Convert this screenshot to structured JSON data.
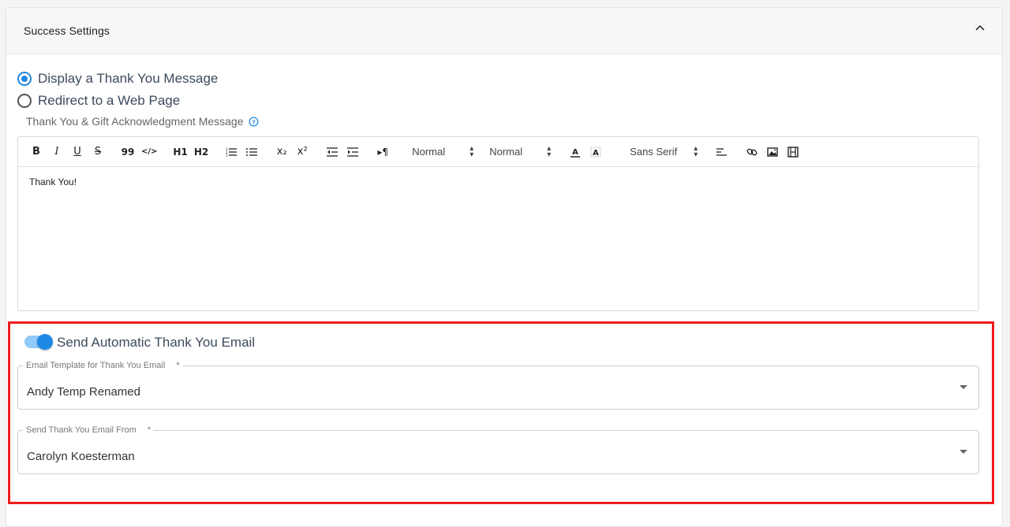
{
  "section": {
    "title": "Success Settings"
  },
  "options": {
    "display_message": "Display a Thank You Message",
    "redirect": "Redirect to a Web Page"
  },
  "message": {
    "label": "Thank You & Gift Acknowledgment Message",
    "body": "Thank You!"
  },
  "toolbar": {
    "bold": "B",
    "italic": "I",
    "underline": "U",
    "strike": "S",
    "blockquote": "99",
    "code": "</>",
    "h1": "H1",
    "h2": "H2",
    "subscript": "x₂",
    "superscript": "x²",
    "rtl": "▸¶",
    "size_select": "Normal",
    "header_select": "Normal",
    "font_select": "Sans Serif"
  },
  "email": {
    "toggle_label": "Send Automatic Thank You Email",
    "template_label": "Email Template for Thank You Email",
    "template_value": "Andy Temp Renamed",
    "from_label": "Send Thank You Email From",
    "from_value": "Carolyn Koesterman",
    "required_mark": "*"
  },
  "colors": {
    "accent": "#1e88e5",
    "highlight": "#ee1c1c"
  }
}
